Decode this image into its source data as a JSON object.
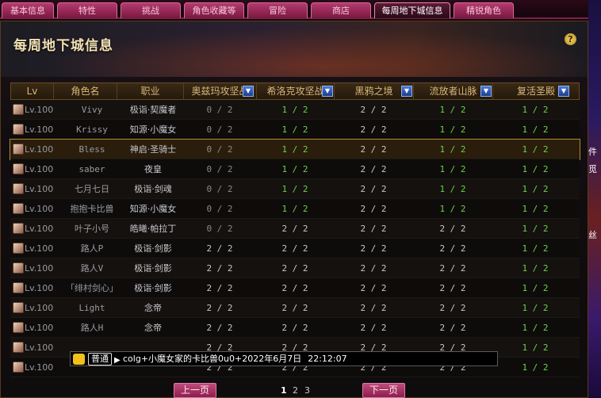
{
  "tabs": [
    {
      "label": "基本信息",
      "active": false
    },
    {
      "label": "特性",
      "active": false
    },
    {
      "label": "挑战",
      "active": false
    },
    {
      "label": "角色收藏等",
      "active": false
    },
    {
      "label": "冒险",
      "active": false
    },
    {
      "label": "商店",
      "active": false
    },
    {
      "label": "每周地下城信息",
      "active": true
    },
    {
      "label": "精锐角色",
      "active": false
    }
  ],
  "page_title": "每周地下城信息",
  "help_glyph": "?",
  "columns": {
    "lv": "Lv",
    "name": "角色名",
    "job": "职业",
    "d1": "奥兹玛攻坚战",
    "d2": "希洛克攻坚战",
    "d3": "黑鸦之境",
    "d4": "流放者山脉",
    "d5": "复活圣殿"
  },
  "dropdown_glyph": "▼",
  "rows": [
    {
      "lv": "Lv.100",
      "name": "Vivy",
      "job": "极诣·契魔者",
      "d1": "0 / 2",
      "d2": "1 / 2",
      "d3": "2 / 2",
      "d4": "1 / 2",
      "d5": "1 / 2",
      "selected": false
    },
    {
      "lv": "Lv.100",
      "name": "Krissy",
      "job": "知源·小魔女",
      "d1": "0 / 2",
      "d2": "1 / 2",
      "d3": "2 / 2",
      "d4": "1 / 2",
      "d5": "1 / 2",
      "selected": false
    },
    {
      "lv": "Lv.100",
      "name": "Bless",
      "job": "神启·圣骑士",
      "d1": "0 / 2",
      "d2": "1 / 2",
      "d3": "2 / 2",
      "d4": "1 / 2",
      "d5": "1 / 2",
      "selected": true
    },
    {
      "lv": "Lv.100",
      "name": "saber",
      "job": "夜皇",
      "d1": "0 / 2",
      "d2": "1 / 2",
      "d3": "2 / 2",
      "d4": "1 / 2",
      "d5": "1 / 2",
      "selected": false
    },
    {
      "lv": "Lv.100",
      "name": "七月七日",
      "job": "极诣·剑魂",
      "d1": "0 / 2",
      "d2": "1 / 2",
      "d3": "2 / 2",
      "d4": "1 / 2",
      "d5": "1 / 2",
      "selected": false
    },
    {
      "lv": "Lv.100",
      "name": "抱抱卡比兽",
      "job": "知源·小魔女",
      "d1": "0 / 2",
      "d2": "1 / 2",
      "d3": "2 / 2",
      "d4": "1 / 2",
      "d5": "1 / 2",
      "selected": false
    },
    {
      "lv": "Lv.100",
      "name": "叶子小号",
      "job": "皓曦·帕拉丁",
      "d1": "0 / 2",
      "d2": "2 / 2",
      "d3": "2 / 2",
      "d4": "2 / 2",
      "d5": "1 / 2",
      "selected": false
    },
    {
      "lv": "Lv.100",
      "name": "路人P",
      "job": "极诣·剑影",
      "d1": "2 / 2",
      "d2": "2 / 2",
      "d3": "2 / 2",
      "d4": "2 / 2",
      "d5": "1 / 2",
      "selected": false
    },
    {
      "lv": "Lv.100",
      "name": "路人V",
      "job": "极诣·剑影",
      "d1": "2 / 2",
      "d2": "2 / 2",
      "d3": "2 / 2",
      "d4": "2 / 2",
      "d5": "1 / 2",
      "selected": false
    },
    {
      "lv": "Lv.100",
      "name": "「绯村剑心」",
      "job": "极诣·剑影",
      "d1": "2 / 2",
      "d2": "2 / 2",
      "d3": "2 / 2",
      "d4": "2 / 2",
      "d5": "1 / 2",
      "selected": false
    },
    {
      "lv": "Lv.100",
      "name": "Light",
      "job": "念帝",
      "d1": "2 / 2",
      "d2": "2 / 2",
      "d3": "2 / 2",
      "d4": "2 / 2",
      "d5": "1 / 2",
      "selected": false
    },
    {
      "lv": "Lv.100",
      "name": "路人H",
      "job": "念帝",
      "d1": "2 / 2",
      "d2": "2 / 2",
      "d3": "2 / 2",
      "d4": "2 / 2",
      "d5": "1 / 2",
      "selected": false
    },
    {
      "lv": "Lv.100",
      "name": "",
      "job": "",
      "d1": "2 / 2",
      "d2": "2 / 2",
      "d3": "2 / 2",
      "d4": "2 / 2",
      "d5": "1 / 2",
      "selected": false
    },
    {
      "lv": "Lv.100",
      "name": "",
      "job": "",
      "d1": "2 / 2",
      "d2": "2 / 2",
      "d3": "2 / 2",
      "d4": "2 / 2",
      "d5": "1 / 2",
      "selected": false
    }
  ],
  "chat": {
    "channel": "普通",
    "arrow": "▶",
    "message": "colg+小魔女家的卡比兽0u0+2022年6月7日",
    "time": "22:12:07"
  },
  "pager": {
    "prev": "上一页",
    "next": "下一页",
    "pages": [
      "1",
      "2",
      "3"
    ],
    "current": "1"
  },
  "colors": {
    "accent_pink": "#b43a6e",
    "complete_green": "#6ad24a",
    "gold_text": "#d9b97a",
    "dropdown_blue": "#2d5dc8"
  },
  "right_strip_text": [
    "件",
    "觅",
    "丝"
  ]
}
